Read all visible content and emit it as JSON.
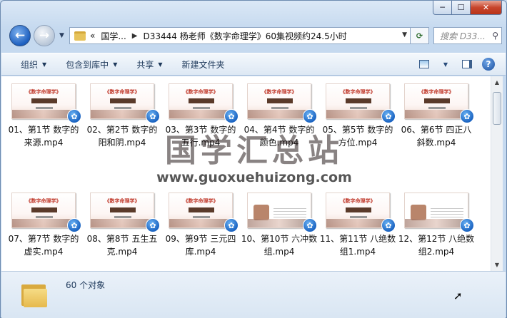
{
  "window": {
    "caption": {
      "minimize": "─",
      "maximize": "☐",
      "close": "✕"
    }
  },
  "nav": {
    "back_glyph": "←",
    "forward_glyph": "→",
    "breadcrumb_overflow": "«",
    "breadcrumb_root": "国学...",
    "breadcrumb_current": "D33444 杨老师《数字命理学》60集视频约24.5小时",
    "search_placeholder": "搜索 D33...",
    "refresh_glyph": "⟳"
  },
  "toolbar": {
    "items": [
      "组织",
      "包含到库中",
      "共享",
      "新建文件夹"
    ]
  },
  "thumbnail": {
    "title": "《数字命理学》"
  },
  "files": [
    {
      "name": "01、第1节 数字的来源.mp4",
      "style": "slide"
    },
    {
      "name": "02、第2节 数字的阳和阴.mp4",
      "style": "slide"
    },
    {
      "name": "03、第3节 数字的五行.mp4",
      "style": "slide"
    },
    {
      "name": "04、第4节 数字的颜色.mp4",
      "style": "slide"
    },
    {
      "name": "05、第5节 数字的方位.mp4",
      "style": "slide"
    },
    {
      "name": "06、第6节 四正八斜数.mp4",
      "style": "slide"
    },
    {
      "name": "07、第7节 数字的虚实.mp4",
      "style": "slide"
    },
    {
      "name": "08、第8节 五生五克.mp4",
      "style": "slide"
    },
    {
      "name": "09、第9节 三元四库.mp4",
      "style": "slide"
    },
    {
      "name": "10、第10节 六冲数组.mp4",
      "style": "alt"
    },
    {
      "name": "11、第11节 八绝数组1.mp4",
      "style": "slide"
    },
    {
      "name": "12、第12节 八绝数组2.mp4",
      "style": "alt"
    }
  ],
  "watermark": {
    "title": "国学汇总站",
    "url": "www.guoxuehuizong.com"
  },
  "details": {
    "count_text": "60 个对象"
  }
}
